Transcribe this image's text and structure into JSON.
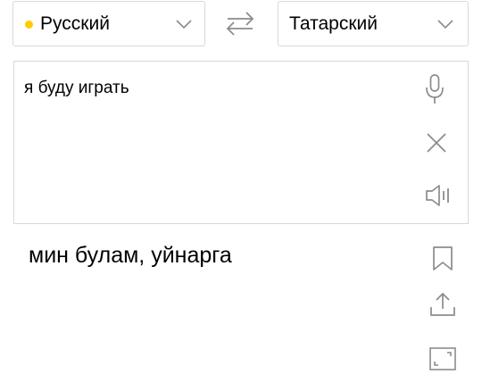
{
  "source_language": {
    "label": "Русский",
    "dot_color": "#ffcc00"
  },
  "target_language": {
    "label": "Татарский"
  },
  "source": {
    "text": "я буду играть"
  },
  "translation": {
    "text": "мин булам, уйнарга"
  },
  "icons": {
    "chevron": "chevron-down-icon",
    "swap": "swap-arrows-icon",
    "microphone": "microphone-icon",
    "clear": "close-icon",
    "speaker": "speaker-icon",
    "bookmark": "bookmark-icon",
    "share": "share-icon",
    "fullscreen": "fullscreen-icon"
  },
  "colors": {
    "icon": "#8c8c8c",
    "border": "#d9d9d9",
    "accent_dot": "#ffcc00"
  }
}
